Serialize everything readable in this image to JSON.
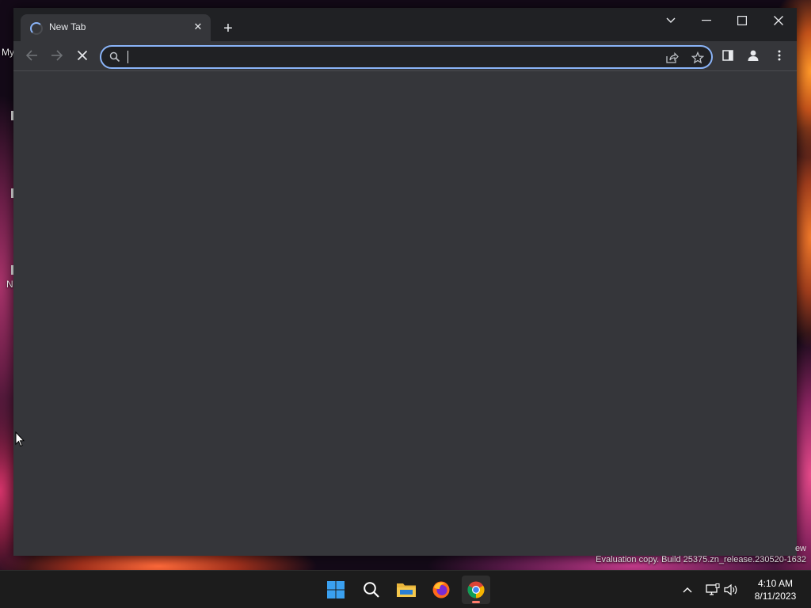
{
  "desktop": {
    "label_top": "My",
    "label_mid": "N",
    "watermark": "Evaluation copy. Build 25375.zn_release.230520-1632",
    "watermark_edge": "ew"
  },
  "browser": {
    "tab": {
      "title": "New Tab",
      "status": "loading"
    },
    "new_tab_label": "+",
    "omnibox": {
      "value": "",
      "placeholder": ""
    },
    "buttons": {
      "back": "back",
      "forward": "forward",
      "stop": "stop",
      "share": "share",
      "bookmark": "bookmark",
      "side_panel": "side-panel",
      "profile": "profile",
      "menu": "menu"
    },
    "colors": {
      "frame": "#202124",
      "toolbar": "#35363a",
      "focus_ring": "#8ab4f8"
    }
  },
  "taskbar": {
    "apps": [
      "windows-start",
      "search",
      "file-explorer",
      "firefox",
      "chrome"
    ],
    "active_app": "chrome",
    "clock": {
      "time": "4:10 AM",
      "date": "8/11/2023"
    }
  }
}
